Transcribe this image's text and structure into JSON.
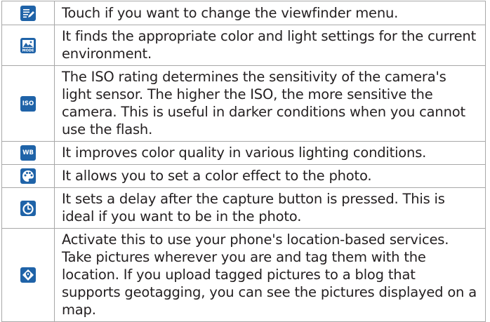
{
  "rows": [
    {
      "icon": "viewfinder-menu-icon",
      "text": "Touch if you want to change the viewfinder menu."
    },
    {
      "icon": "scene-mode-icon",
      "text": "It finds the appropriate color and light settings for the current environment."
    },
    {
      "icon": "iso-icon",
      "icon_label": "ISO",
      "text": "The ISO rating determines the sensitivity of the camera's light sensor. The higher the ISO, the more sensitive the camera. This is useful in darker conditions when you cannot use the flash."
    },
    {
      "icon": "white-balance-icon",
      "icon_label": "WB",
      "text": "It improves color quality in various lighting conditions."
    },
    {
      "icon": "color-effect-icon",
      "text": "It allows you to set a color effect to the photo."
    },
    {
      "icon": "timer-icon",
      "text": "It sets a delay after the capture button is pressed. This is ideal if you want to be in the photo."
    },
    {
      "icon": "geotag-icon",
      "text": "Activate this to use your phone's location-based services. Take pictures wherever you are and tag them with the location. If you upload tagged pictures to a blog that supports geotagging, you can see the pictures displayed on a map."
    }
  ],
  "colors": {
    "icon_bg": "#1f63a8",
    "border": "#a8a8a8",
    "text": "#231f20"
  }
}
